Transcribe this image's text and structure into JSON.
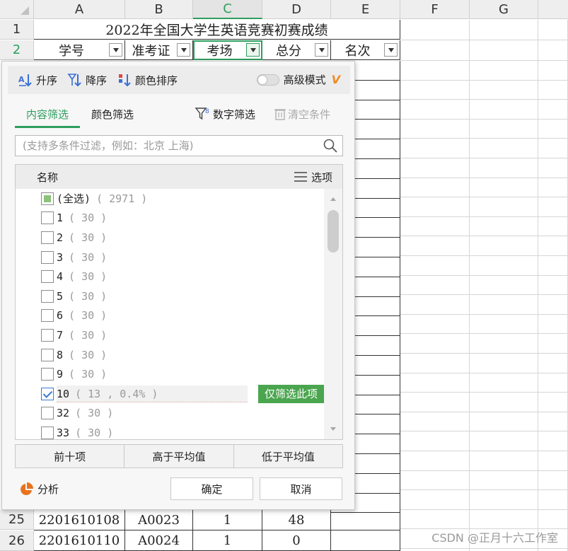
{
  "sheet": {
    "columns": [
      "A",
      "B",
      "C",
      "D",
      "E",
      "F",
      "G"
    ],
    "rows": [
      "1",
      "2",
      "25",
      "26"
    ],
    "title": "2022年全国大学生英语竞赛初赛成绩",
    "headers": [
      "学号",
      "准考证",
      "考场",
      "总分",
      "名次"
    ],
    "data_rows": [
      [
        "2201610108",
        "A0023",
        "1",
        "48"
      ],
      [
        "2201610110",
        "A0024",
        "1",
        "0"
      ]
    ],
    "active_column": "C",
    "active_row": "2"
  },
  "filter": {
    "sort_asc": "升序",
    "sort_desc": "降序",
    "sort_color": "颜色排序",
    "advanced_mode": "高级模式",
    "tab_content": "内容筛选",
    "tab_color": "颜色筛选",
    "number_filter": "数字筛选",
    "clear": "清空条件",
    "search_placeholder": "(支持多条件过滤，例如：北京 上海)",
    "list_header": "名称",
    "options_label": "选项",
    "items": [
      {
        "label": "(全选)",
        "count": "( 2971 )",
        "state": "partial"
      },
      {
        "label": "1",
        "count": "( 30 )",
        "state": "unchecked"
      },
      {
        "label": "2",
        "count": "( 30 )",
        "state": "unchecked"
      },
      {
        "label": "3",
        "count": "( 30 )",
        "state": "unchecked"
      },
      {
        "label": "4",
        "count": "( 30 )",
        "state": "unchecked"
      },
      {
        "label": "5",
        "count": "( 30 )",
        "state": "unchecked"
      },
      {
        "label": "6",
        "count": "( 30 )",
        "state": "unchecked"
      },
      {
        "label": "7",
        "count": "( 30 )",
        "state": "unchecked"
      },
      {
        "label": "8",
        "count": "( 30 )",
        "state": "unchecked"
      },
      {
        "label": "9",
        "count": "( 30 )",
        "state": "unchecked"
      },
      {
        "label": "10",
        "count": "( 13 , 0.4% )",
        "state": "checked"
      },
      {
        "label": "32",
        "count": "( 30 )",
        "state": "unchecked"
      },
      {
        "label": "33",
        "count": "( 30 )",
        "state": "unchecked"
      }
    ],
    "only_this": "仅筛选此项",
    "top10": "前十项",
    "above_avg": "高于平均值",
    "below_avg": "低于平均值",
    "analyze": "分析",
    "ok": "确定",
    "cancel": "取消"
  },
  "watermark": "CSDN @正月十六工作室",
  "colors": {
    "accent": "#2e9e5e",
    "only_button": "#4aa54e",
    "check": "#3a7bd5"
  }
}
